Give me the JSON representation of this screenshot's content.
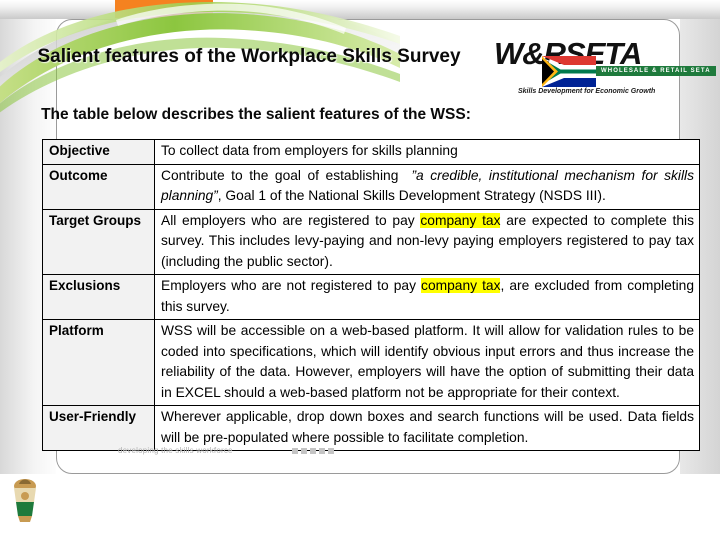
{
  "brand": {
    "logo_word": "W&RSETA",
    "logo_banner": "WHOLESALE & RETAIL SETA",
    "logo_tagline": "Skills Development for Economic Growth",
    "accent_orange": "#F58220",
    "accent_green": "#8CC63F",
    "banner_green": "#1E7A3C",
    "highlight_yellow": "#FFFF00"
  },
  "title": "Salient features of the Workplace Skills Survey",
  "subtitle": "The table below describes the salient features of the WSS:",
  "table": {
    "rows": [
      {
        "label": "Objective",
        "text": "To collect data from employers for  skills planning"
      },
      {
        "label": "Outcome",
        "text": "Contribute to the goal of establishing  ”a credible, institutional mechanism for skills planning” , Goal 1 of the National Skills Development Strategy (NSDS III).",
        "part_plain_1": "Contribute to the goal of establishing",
        "part_italic": "”a credible, institutional mechanism for skills planning”",
        "part_plain_2": ", Goal 1 of the National Skills Development Strategy (NSDS III)."
      },
      {
        "label": "Target Groups",
        "text": "All employers who are registered to pay company tax are expected to complete this survey. This includes levy-paying and non-levy paying employers registered to pay tax (including the public sector).",
        "part_plain_1": "All employers who are registered to pay ",
        "part_highlight": "company tax",
        "part_plain_2": " are expected to complete this survey. This includes levy-paying and non-levy paying employers registered to pay tax (including the public sector)."
      },
      {
        "label": "Exclusions",
        "text": "Employers who are not registered to pay company tax, are excluded from completing this survey.",
        "part_plain_1": "Employers who are not registered to pay ",
        "part_highlight": "company tax",
        "part_plain_2": ", are excluded from completing this survey."
      },
      {
        "label": "Platform",
        "text": "WSS will be accessible on a web-based platform. It will allow for validation rules to be coded into specifications, which will identify obvious input errors and thus increase the reliability of the data. However, employers will have the option of submitting their data in EXCEL should a web-based platform not be appropriate for their context."
      },
      {
        "label": "User-Friendly",
        "text": "Wherever applicable, drop down boxes and search functions will be used. Data fields will be pre-populated where possible to facilitate completion."
      }
    ]
  },
  "footer": {
    "note": "developing the skills workforce",
    "dots": 5
  },
  "icons": {
    "crest": "south-africa-coat-of-arms-icon",
    "flag": "south-africa-flag-icon"
  }
}
